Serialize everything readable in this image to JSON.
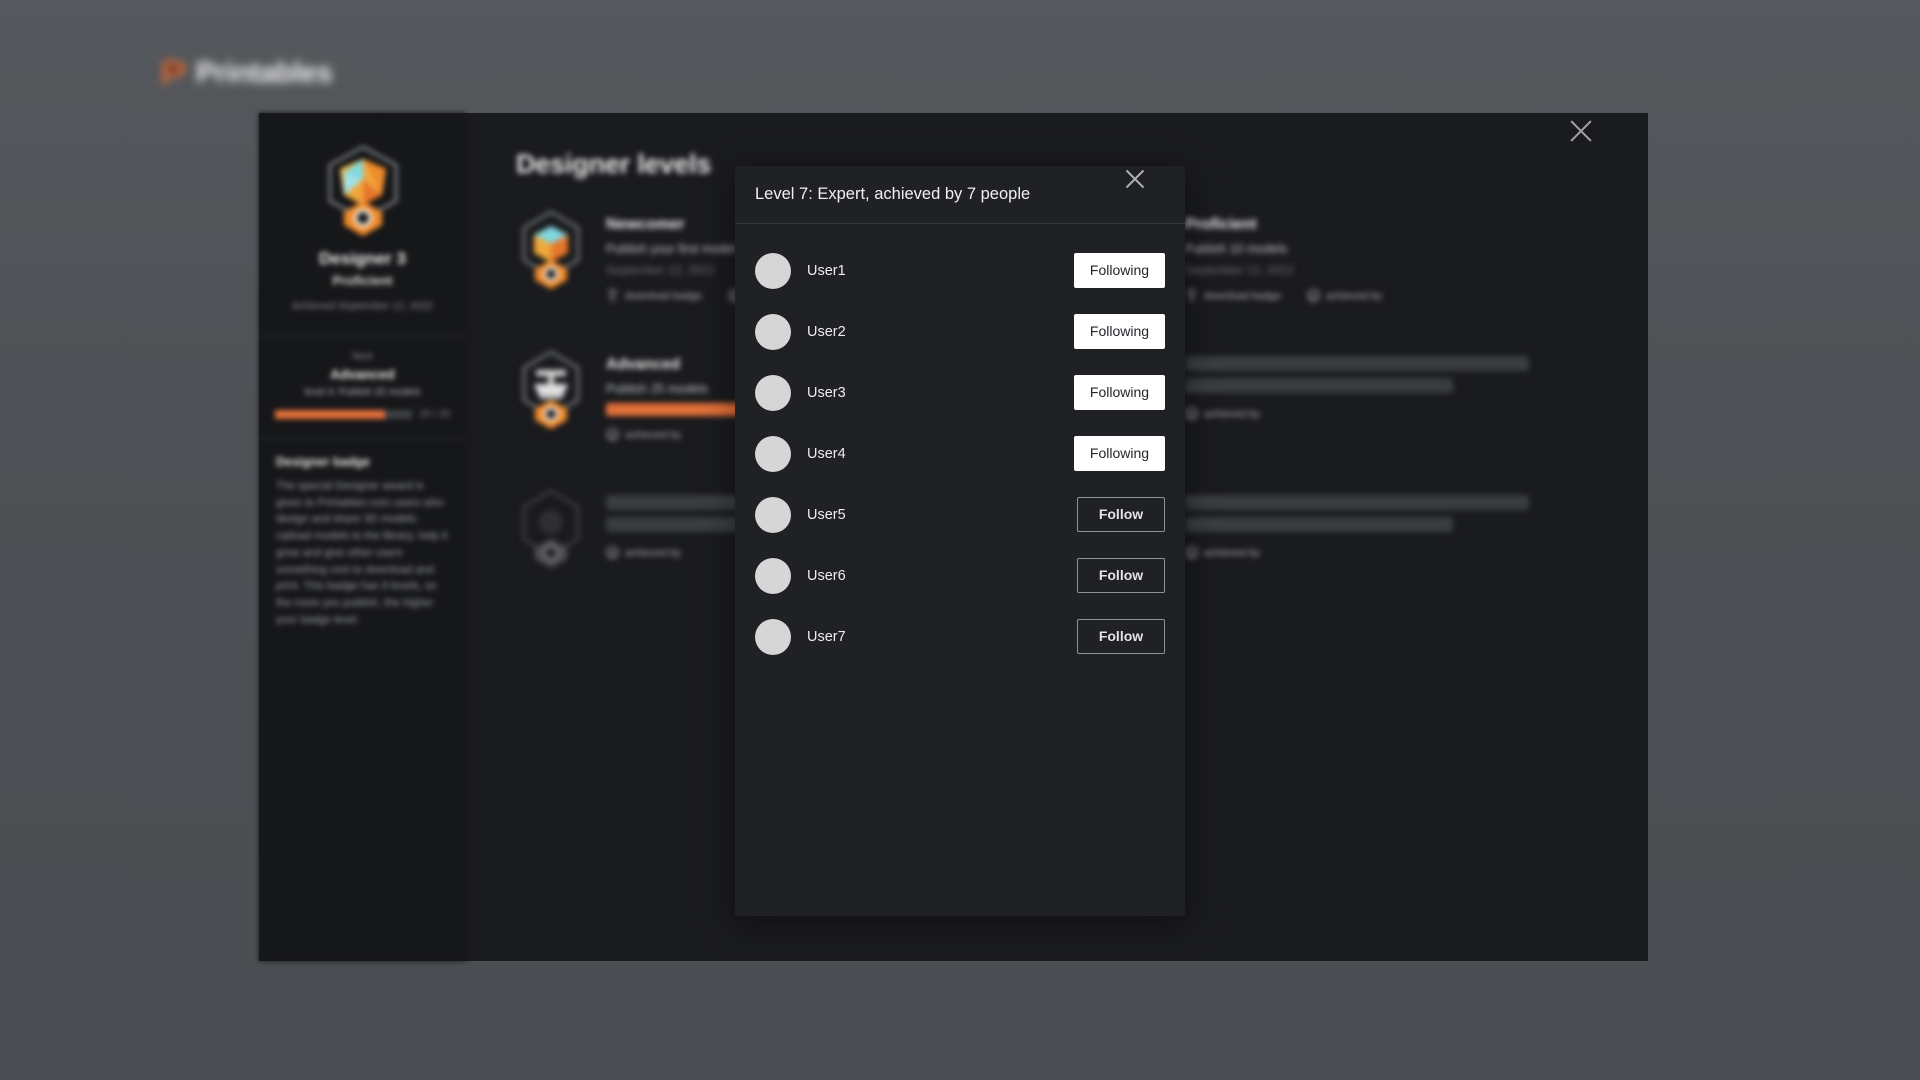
{
  "site": {
    "logo_text": "Printables",
    "logo_icon": "printables-logo-icon",
    "accent_color": "#e2703a"
  },
  "page_panel": {
    "close_icon": "close-icon",
    "sidebar": {
      "badge_icon": "designer-badge-icon",
      "level_title": "Designer 3",
      "level_name": "Proficient",
      "achieved_text": "Achieved September 12, 2022",
      "next": {
        "label": "Next",
        "name": "Advanced",
        "requirement": "level 4: Publish 25 models",
        "progress_percent": 80,
        "progress_text": "20 / 25"
      },
      "description": {
        "title": "Designer badge",
        "body": "The special Designer award is given to Printables.com users who design and share 3D models. Upload models to the library, help it grow and give other users something cool to download and print. This badge has 9 levels, so the more you publish, the higher your badge level."
      }
    },
    "main": {
      "title": "Designer levels",
      "download_badge_label": "download badge",
      "achieved_by_label": "achieved by",
      "trophy_icon": "trophy-icon",
      "people-icon": "people-icon",
      "levels": [
        {
          "name": "Newcomer",
          "requirement": "Publish your first model",
          "date": "September 12, 2022",
          "state": "achieved",
          "badge_icon": "newcomer-badge-icon",
          "actions": [
            "download badge",
            "achieved by"
          ]
        },
        {
          "name": "Proficient",
          "requirement": "Publish 10 models",
          "date": "September 12, 2022",
          "state": "achieved",
          "badge_icon": "proficient-badge-icon",
          "actions": [
            "download badge",
            "achieved by"
          ]
        },
        {
          "name": "Advanced",
          "requirement": "Publish 25 models",
          "date": "",
          "state": "in-progress",
          "badge_icon": "advanced-badge-icon",
          "progress_percent": 100,
          "actions": [
            "achieved by"
          ]
        },
        {
          "name": "",
          "requirement": "",
          "date": "",
          "state": "locked",
          "badge_icon": "locked-badge-icon",
          "actions": [
            "achieved by"
          ]
        },
        {
          "name": "",
          "requirement": "",
          "date": "",
          "state": "locked",
          "badge_icon": "locked-badge-icon",
          "actions": [
            "achieved by"
          ]
        },
        {
          "name": "",
          "requirement": "",
          "date": "",
          "state": "locked",
          "badge_icon": "locked-badge-icon",
          "actions": [
            "achieved by"
          ]
        }
      ]
    }
  },
  "modal": {
    "title": "Level 7: Expert, achieved by 7 people",
    "close_icon": "close-icon",
    "users": [
      {
        "name": "User1",
        "button_label": "Following",
        "button_state": "following"
      },
      {
        "name": "User2",
        "button_label": "Following",
        "button_state": "following"
      },
      {
        "name": "User3",
        "button_label": "Following",
        "button_state": "following"
      },
      {
        "name": "User4",
        "button_label": "Following",
        "button_state": "following"
      },
      {
        "name": "User5",
        "button_label": "Follow",
        "button_state": "follow"
      },
      {
        "name": "User6",
        "button_label": "Follow",
        "button_state": "follow"
      },
      {
        "name": "User7",
        "button_label": "Follow",
        "button_state": "follow"
      }
    ]
  }
}
